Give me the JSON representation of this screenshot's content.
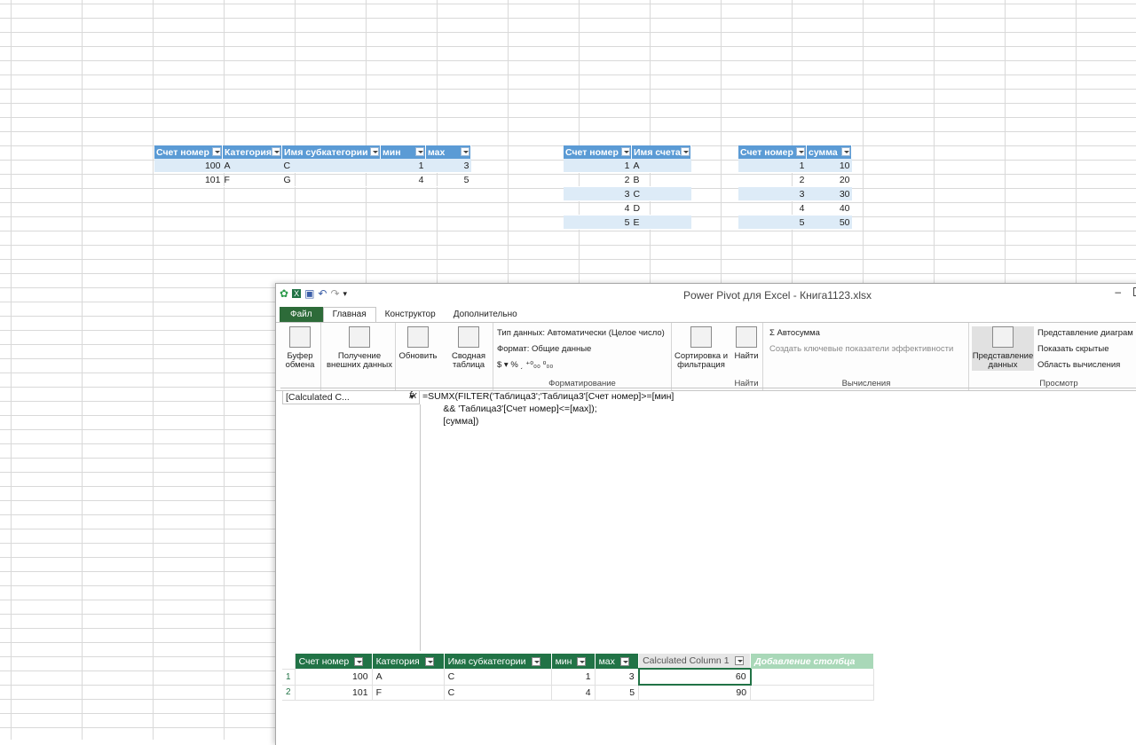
{
  "table1": {
    "headers": [
      "Счет номер",
      "Категория",
      "Имя субкатегории",
      "мин",
      "мах"
    ],
    "rows": [
      [
        "100",
        "A",
        "C",
        "1",
        "3"
      ],
      [
        "101",
        "F",
        "G",
        "4",
        "5"
      ]
    ]
  },
  "table2": {
    "headers": [
      "Счет номер",
      "Имя счета"
    ],
    "rows": [
      [
        "1",
        "A"
      ],
      [
        "2",
        "B"
      ],
      [
        "3",
        "C"
      ],
      [
        "4",
        "D"
      ],
      [
        "5",
        "E"
      ]
    ]
  },
  "table3": {
    "headers": [
      "Счет номер",
      "сумма"
    ],
    "rows": [
      [
        "1",
        "10"
      ],
      [
        "2",
        "20"
      ],
      [
        "3",
        "30"
      ],
      [
        "4",
        "40"
      ],
      [
        "5",
        "50"
      ]
    ]
  },
  "pp": {
    "title": "Power Pivot для Excel - Книга1123.xlsx",
    "minimize": "–",
    "tabs": [
      "Файл",
      "Главная",
      "Конструктор",
      "Дополнительно"
    ],
    "ribbon": {
      "clipboard": "Буфер обмена",
      "get_data": "Получение внешних данных",
      "refresh": "Обновить",
      "pivot": "Сводная таблица",
      "datatype": "Тип данных: Автоматически (Целое число)",
      "format": "Формат: Общие данные",
      "numfmt": "$ ▾ % ͵ ⁺⁰₀₀ ⁰₀₀",
      "formatting_group": "Форматирование",
      "sort": "Сортировка и фильтрация",
      "find": "Найти",
      "find_group": "Найти",
      "autosum": "Σ Автосумма",
      "kpi": "Создать ключевые показатели эффективности",
      "calc_group": "Вычисления",
      "dataview": "Представление данных",
      "diagramview": "Представление диаграм",
      "showhidden": "Показать скрытые",
      "calcarea": "Область вычисления",
      "view_group": "Просмотр"
    },
    "namebox": "[Calculated C...",
    "formula_lines": [
      "=SUMX(FILTER('Таблица3';'Таблица3'[Счет номер]>=[мин]",
      "        && 'Таблица3'[Счет номер]<=[мах]);",
      "        [сумма])"
    ],
    "grid": {
      "headers": [
        "Счет номер",
        "Категория",
        "Имя субкатегории",
        "мин",
        "мах",
        "Calculated Column 1",
        "Добавление столбца"
      ],
      "rows": [
        [
          "1",
          "100",
          "A",
          "C",
          "1",
          "3",
          "60"
        ],
        [
          "2",
          "101",
          "F",
          "C",
          "4",
          "5",
          "90"
        ]
      ]
    }
  }
}
